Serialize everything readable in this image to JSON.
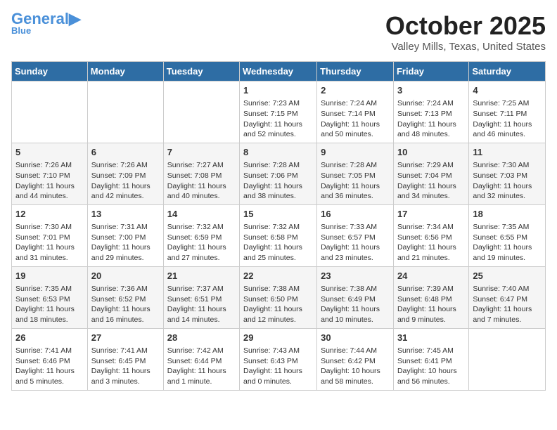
{
  "header": {
    "logo_general": "General",
    "logo_blue": "Blue",
    "month": "October 2025",
    "location": "Valley Mills, Texas, United States"
  },
  "days_of_week": [
    "Sunday",
    "Monday",
    "Tuesday",
    "Wednesday",
    "Thursday",
    "Friday",
    "Saturday"
  ],
  "weeks": [
    [
      {
        "day": "",
        "content": ""
      },
      {
        "day": "",
        "content": ""
      },
      {
        "day": "",
        "content": ""
      },
      {
        "day": "1",
        "content": "Sunrise: 7:23 AM\nSunset: 7:15 PM\nDaylight: 11 hours and 52 minutes."
      },
      {
        "day": "2",
        "content": "Sunrise: 7:24 AM\nSunset: 7:14 PM\nDaylight: 11 hours and 50 minutes."
      },
      {
        "day": "3",
        "content": "Sunrise: 7:24 AM\nSunset: 7:13 PM\nDaylight: 11 hours and 48 minutes."
      },
      {
        "day": "4",
        "content": "Sunrise: 7:25 AM\nSunset: 7:11 PM\nDaylight: 11 hours and 46 minutes."
      }
    ],
    [
      {
        "day": "5",
        "content": "Sunrise: 7:26 AM\nSunset: 7:10 PM\nDaylight: 11 hours and 44 minutes."
      },
      {
        "day": "6",
        "content": "Sunrise: 7:26 AM\nSunset: 7:09 PM\nDaylight: 11 hours and 42 minutes."
      },
      {
        "day": "7",
        "content": "Sunrise: 7:27 AM\nSunset: 7:08 PM\nDaylight: 11 hours and 40 minutes."
      },
      {
        "day": "8",
        "content": "Sunrise: 7:28 AM\nSunset: 7:06 PM\nDaylight: 11 hours and 38 minutes."
      },
      {
        "day": "9",
        "content": "Sunrise: 7:28 AM\nSunset: 7:05 PM\nDaylight: 11 hours and 36 minutes."
      },
      {
        "day": "10",
        "content": "Sunrise: 7:29 AM\nSunset: 7:04 PM\nDaylight: 11 hours and 34 minutes."
      },
      {
        "day": "11",
        "content": "Sunrise: 7:30 AM\nSunset: 7:03 PM\nDaylight: 11 hours and 32 minutes."
      }
    ],
    [
      {
        "day": "12",
        "content": "Sunrise: 7:30 AM\nSunset: 7:01 PM\nDaylight: 11 hours and 31 minutes."
      },
      {
        "day": "13",
        "content": "Sunrise: 7:31 AM\nSunset: 7:00 PM\nDaylight: 11 hours and 29 minutes."
      },
      {
        "day": "14",
        "content": "Sunrise: 7:32 AM\nSunset: 6:59 PM\nDaylight: 11 hours and 27 minutes."
      },
      {
        "day": "15",
        "content": "Sunrise: 7:32 AM\nSunset: 6:58 PM\nDaylight: 11 hours and 25 minutes."
      },
      {
        "day": "16",
        "content": "Sunrise: 7:33 AM\nSunset: 6:57 PM\nDaylight: 11 hours and 23 minutes."
      },
      {
        "day": "17",
        "content": "Sunrise: 7:34 AM\nSunset: 6:56 PM\nDaylight: 11 hours and 21 minutes."
      },
      {
        "day": "18",
        "content": "Sunrise: 7:35 AM\nSunset: 6:55 PM\nDaylight: 11 hours and 19 minutes."
      }
    ],
    [
      {
        "day": "19",
        "content": "Sunrise: 7:35 AM\nSunset: 6:53 PM\nDaylight: 11 hours and 18 minutes."
      },
      {
        "day": "20",
        "content": "Sunrise: 7:36 AM\nSunset: 6:52 PM\nDaylight: 11 hours and 16 minutes."
      },
      {
        "day": "21",
        "content": "Sunrise: 7:37 AM\nSunset: 6:51 PM\nDaylight: 11 hours and 14 minutes."
      },
      {
        "day": "22",
        "content": "Sunrise: 7:38 AM\nSunset: 6:50 PM\nDaylight: 11 hours and 12 minutes."
      },
      {
        "day": "23",
        "content": "Sunrise: 7:38 AM\nSunset: 6:49 PM\nDaylight: 11 hours and 10 minutes."
      },
      {
        "day": "24",
        "content": "Sunrise: 7:39 AM\nSunset: 6:48 PM\nDaylight: 11 hours and 9 minutes."
      },
      {
        "day": "25",
        "content": "Sunrise: 7:40 AM\nSunset: 6:47 PM\nDaylight: 11 hours and 7 minutes."
      }
    ],
    [
      {
        "day": "26",
        "content": "Sunrise: 7:41 AM\nSunset: 6:46 PM\nDaylight: 11 hours and 5 minutes."
      },
      {
        "day": "27",
        "content": "Sunrise: 7:41 AM\nSunset: 6:45 PM\nDaylight: 11 hours and 3 minutes."
      },
      {
        "day": "28",
        "content": "Sunrise: 7:42 AM\nSunset: 6:44 PM\nDaylight: 11 hours and 1 minute."
      },
      {
        "day": "29",
        "content": "Sunrise: 7:43 AM\nSunset: 6:43 PM\nDaylight: 11 hours and 0 minutes."
      },
      {
        "day": "30",
        "content": "Sunrise: 7:44 AM\nSunset: 6:42 PM\nDaylight: 10 hours and 58 minutes."
      },
      {
        "day": "31",
        "content": "Sunrise: 7:45 AM\nSunset: 6:41 PM\nDaylight: 10 hours and 56 minutes."
      },
      {
        "day": "",
        "content": ""
      }
    ]
  ]
}
